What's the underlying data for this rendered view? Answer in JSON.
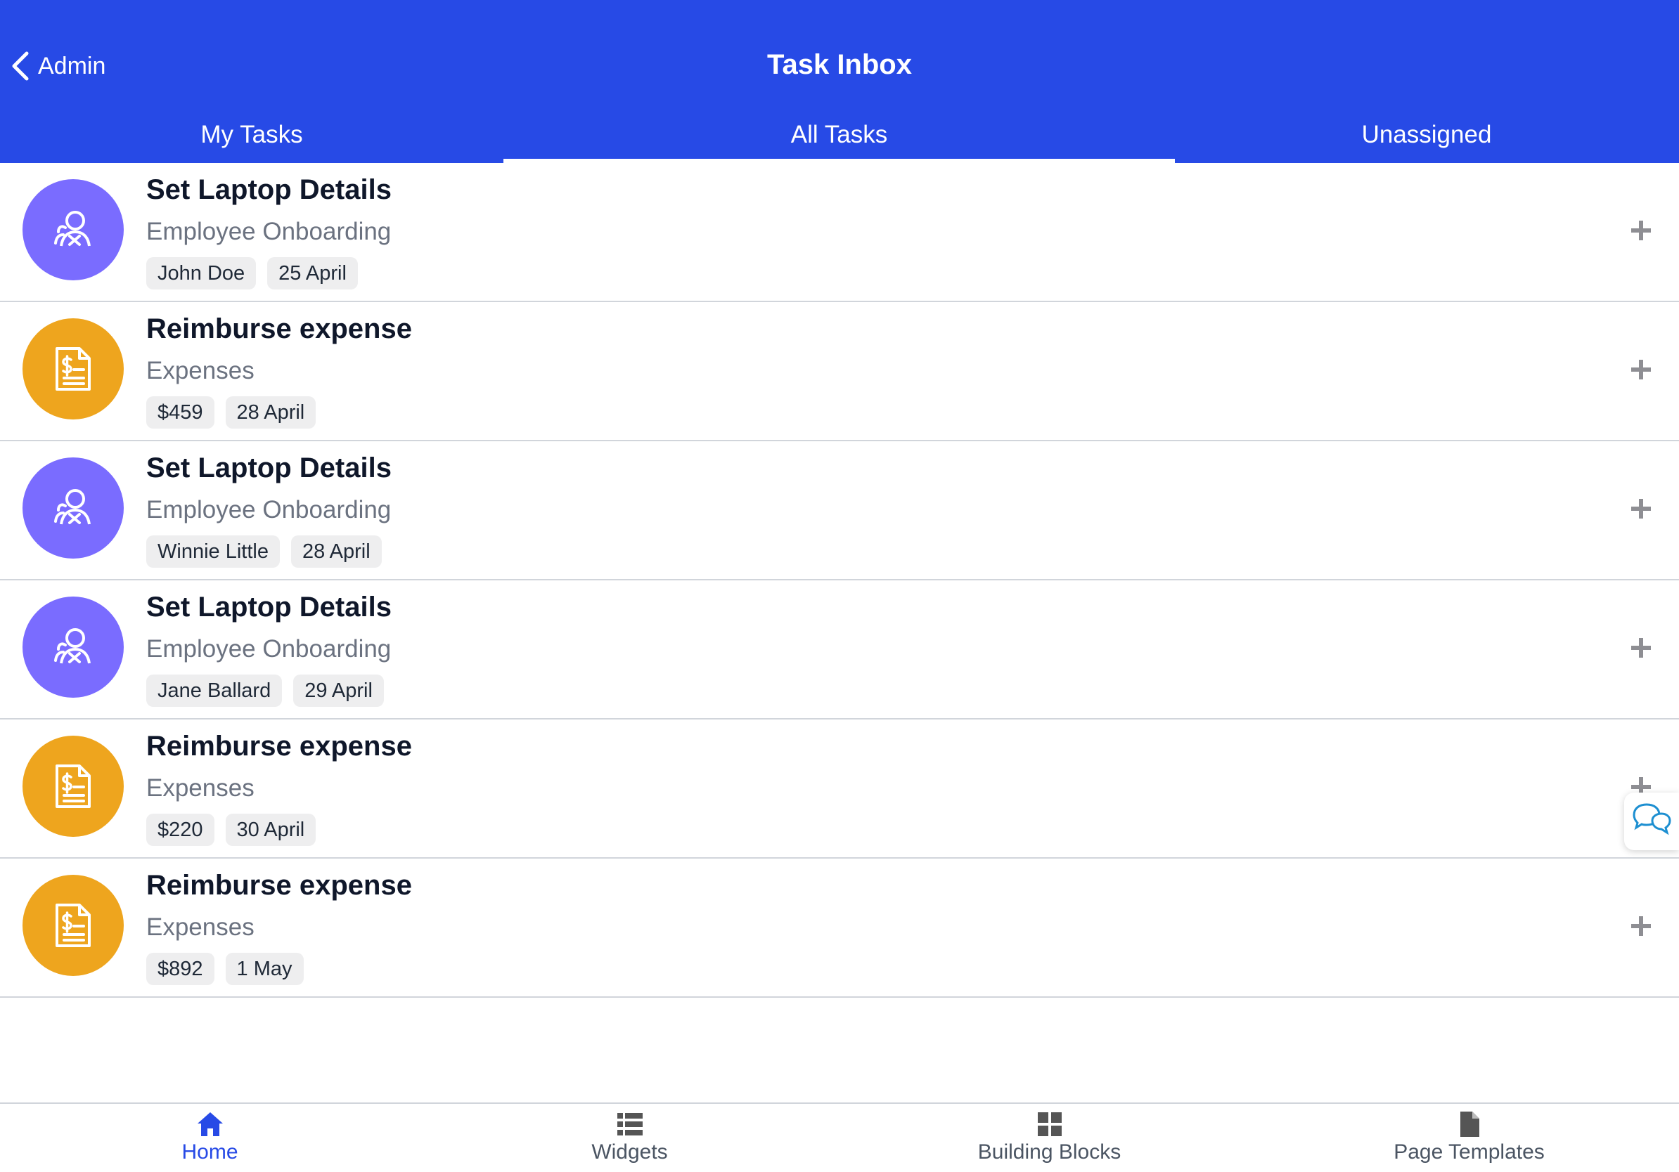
{
  "header": {
    "back_label": "Admin",
    "title": "Task Inbox",
    "background": "#274ae6"
  },
  "tabs": [
    {
      "label": "My Tasks",
      "active": false
    },
    {
      "label": "All Tasks",
      "active": true
    },
    {
      "label": "Unassigned",
      "active": false
    }
  ],
  "tasks": [
    {
      "title": "Set Laptop Details",
      "category": "Employee Onboarding",
      "icon": "users-icon",
      "color": "#7a6cff",
      "chips": [
        "John Doe",
        "25 April"
      ]
    },
    {
      "title": "Reimburse expense",
      "category": "Expenses",
      "icon": "invoice-icon",
      "color": "#eea51e",
      "chips": [
        "$459",
        "28 April"
      ]
    },
    {
      "title": "Set Laptop Details",
      "category": "Employee Onboarding",
      "icon": "users-icon",
      "color": "#7a6cff",
      "chips": [
        "Winnie Little",
        "28 April"
      ]
    },
    {
      "title": "Set Laptop Details",
      "category": "Employee Onboarding",
      "icon": "users-icon",
      "color": "#7a6cff",
      "chips": [
        "Jane Ballard",
        "29 April"
      ]
    },
    {
      "title": "Reimburse expense",
      "category": "Expenses",
      "icon": "invoice-icon",
      "color": "#eea51e",
      "chips": [
        "$220",
        "30 April"
      ]
    },
    {
      "title": "Reimburse expense",
      "category": "Expenses",
      "icon": "invoice-icon",
      "color": "#eea51e",
      "chips": [
        "$892",
        "1 May"
      ]
    }
  ],
  "bottom_nav": [
    {
      "label": "Home",
      "icon": "home-icon",
      "active": true
    },
    {
      "label": "Widgets",
      "icon": "list-icon",
      "active": false
    },
    {
      "label": "Building Blocks",
      "icon": "grid-icon",
      "active": false
    },
    {
      "label": "Page Templates",
      "icon": "document-icon",
      "active": false
    }
  ],
  "colors": {
    "accent": "#274ae6",
    "onboarding": "#7a6cff",
    "expenses": "#eea51e",
    "chat": "#1d8fd1"
  }
}
